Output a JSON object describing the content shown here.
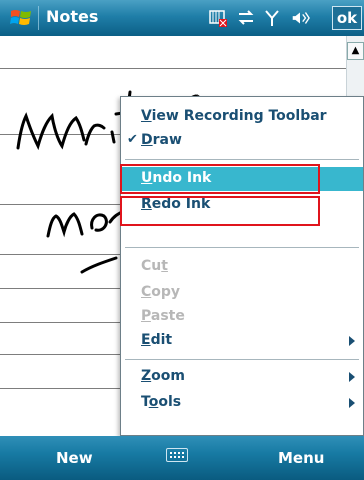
{
  "titlebar": {
    "app_title": "Notes",
    "ok_label": "ok"
  },
  "menu": {
    "items": [
      {
        "label_u": "V",
        "label_rest": "iew Recording Toolbar",
        "checked": false,
        "enabled": true,
        "submenu": false
      },
      {
        "label_u": "D",
        "label_rest": "raw",
        "checked": true,
        "enabled": true,
        "submenu": false
      },
      {
        "label_u": "U",
        "label_rest": "ndo Ink",
        "checked": false,
        "enabled": true,
        "submenu": false,
        "highlighted": true
      },
      {
        "label_u": "R",
        "label_rest": "edo Ink",
        "checked": false,
        "enabled": true,
        "submenu": false
      },
      {
        "label_pre": "Cu",
        "label_u": "t",
        "label_rest": "",
        "checked": false,
        "enabled": false,
        "submenu": false
      },
      {
        "label_u": "C",
        "label_rest": "opy",
        "checked": false,
        "enabled": false,
        "submenu": false
      },
      {
        "label_u": "P",
        "label_rest": "aste",
        "checked": false,
        "enabled": false,
        "submenu": false
      },
      {
        "label_u": "E",
        "label_rest": "dit",
        "checked": false,
        "enabled": true,
        "submenu": true
      },
      {
        "label_u": "Z",
        "label_rest": "oom",
        "checked": false,
        "enabled": true,
        "submenu": true
      },
      {
        "label_pre": "T",
        "label_u": "o",
        "label_rest": "ols",
        "checked": false,
        "enabled": true,
        "submenu": true
      }
    ]
  },
  "softkeys": {
    "left": "New",
    "right": "Menu"
  },
  "colors": {
    "title_bar": "#1f7ea8",
    "highlight": "#38b7ce",
    "callout": "#e0141c",
    "menu_text": "#1a4f73"
  },
  "icons": [
    "windows-start-icon",
    "sim-card-icon",
    "connectivity-icon",
    "signal-icon",
    "volume-icon",
    "keyboard-icon",
    "scroll-up-icon"
  ]
}
